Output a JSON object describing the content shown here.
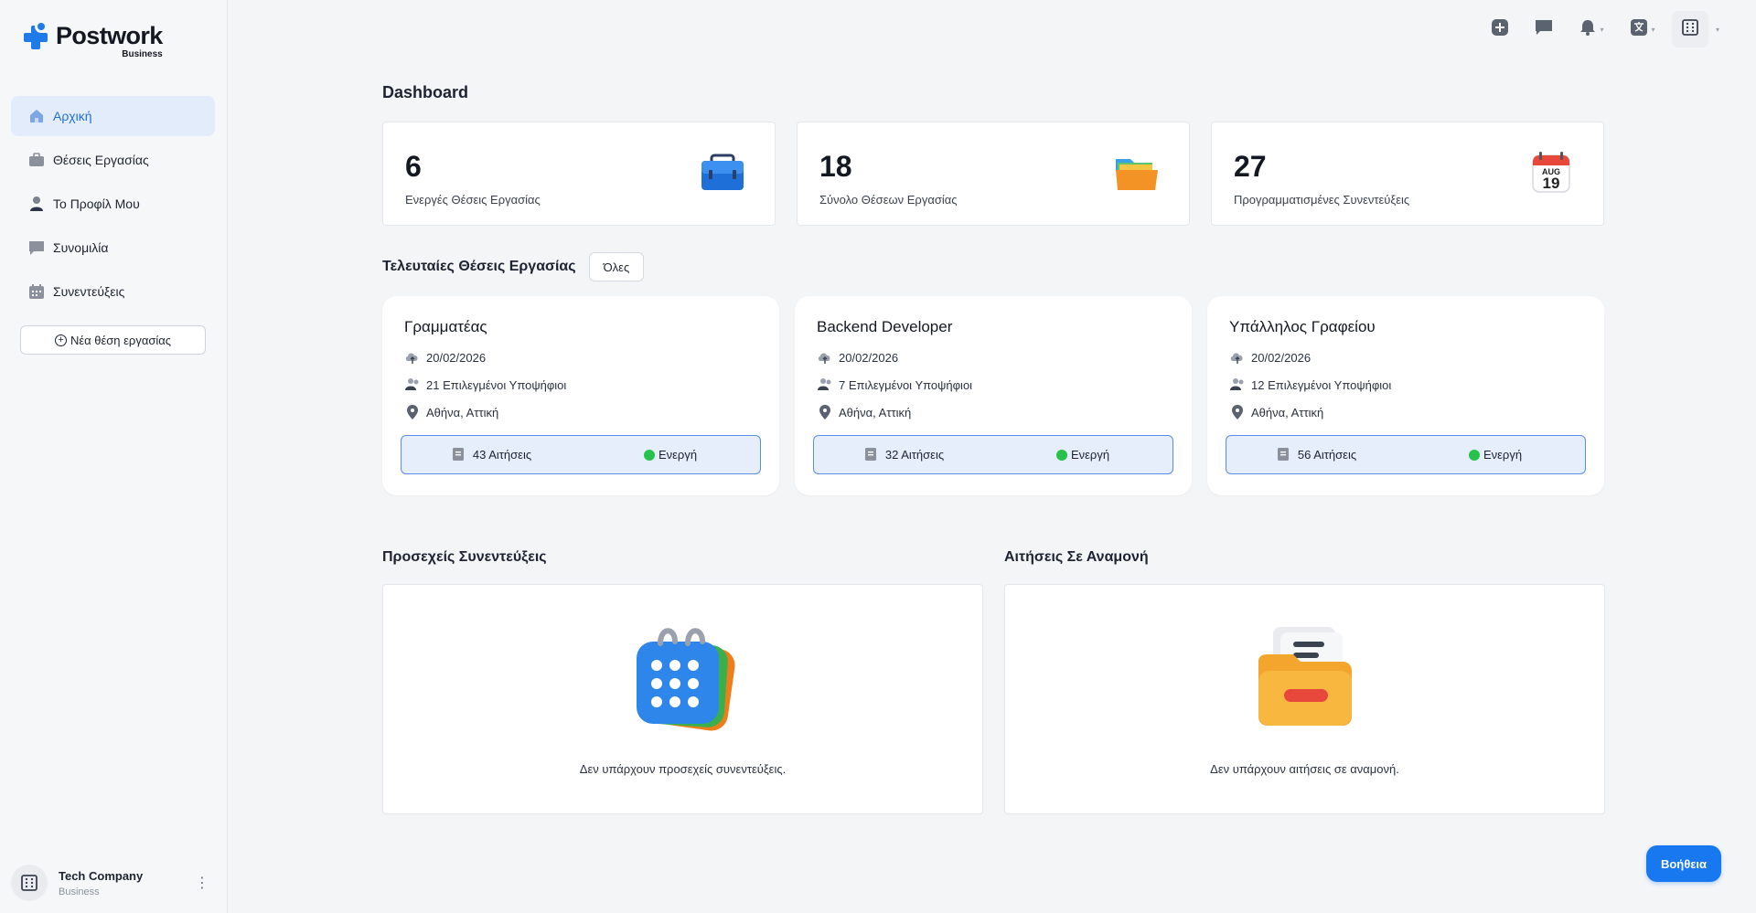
{
  "brand": {
    "name": "Postwork",
    "sub": "Business",
    "accent": "#1f7aea"
  },
  "sidebar": {
    "items": [
      {
        "label": "Αρχική",
        "icon": "home-icon",
        "active": true
      },
      {
        "label": "Θέσεις Εργασίας",
        "icon": "briefcase-icon"
      },
      {
        "label": "Το Προφίλ Μου",
        "icon": "user-icon"
      },
      {
        "label": "Συνομιλία",
        "icon": "chat-icon"
      },
      {
        "label": "Συνεντεύξεις",
        "icon": "calendar-icon"
      }
    ],
    "new_job_label": "Νέα θέση εργασίας",
    "company": {
      "name": "Tech Company",
      "type": "Business"
    }
  },
  "topbar": {
    "icons": [
      "plus-icon",
      "chat-icon",
      "bell-icon",
      "translate-icon",
      "building-icon"
    ]
  },
  "dashboard": {
    "title": "Dashboard",
    "stats": [
      {
        "value": "6",
        "label": "Ενεργές Θέσεις Εργασίας",
        "icon": "briefcase-icon"
      },
      {
        "value": "18",
        "label": "Σύνολο Θέσεων Εργασίας",
        "icon": "folder-icon"
      },
      {
        "value": "27",
        "label": "Προγραμματισμένες Συνεντεύξεις",
        "icon": "calendar-icon"
      }
    ],
    "recent_jobs_title": "Τελευταίες Θέσεις Εργασίας",
    "all_label": "Όλες",
    "jobs": [
      {
        "title": "Γραμματέας",
        "date": "20/02/2026",
        "candidates": "21 Επιλεγμένοι Υποψήφιοι",
        "location": "Αθήνα, Αττική",
        "applications": "43 Αιτήσεις",
        "status": "Ενεργή"
      },
      {
        "title": "Backend Developer",
        "date": "20/02/2026",
        "candidates": "7 Επιλεγμένοι Υποψήφιοι",
        "location": "Αθήνα, Αττική",
        "applications": "32 Αιτήσεις",
        "status": "Ενεργή"
      },
      {
        "title": "Υπάλληλος Γραφείου",
        "date": "20/02/2026",
        "candidates": "12 Επιλεγμένοι Υποψήφιοι",
        "location": "Αθήνα, Αττική",
        "applications": "56 Αιτήσεις",
        "status": "Ενεργή"
      }
    ],
    "upcoming_title": "Προσεχείς Συνεντεύξεις",
    "upcoming_empty": "Δεν υπάρχουν προσεχείς συνεντεύξεις.",
    "pending_title": "Αιτήσεις Σε Αναμονή",
    "pending_empty": "Δεν υπάρχουν αιτήσεις σε αναμονή."
  },
  "calendar_badge": {
    "month": "AUG",
    "day": "19"
  },
  "help_label": "Βοήθεια"
}
